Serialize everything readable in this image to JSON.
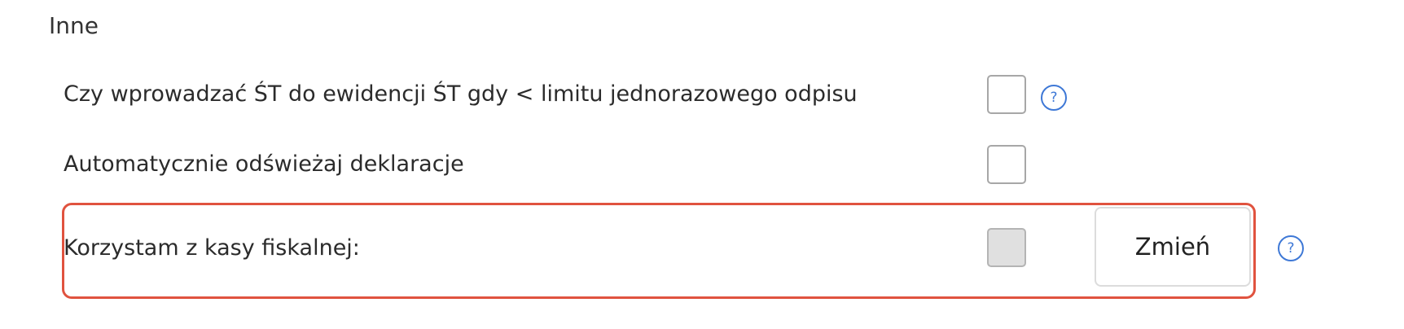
{
  "section": {
    "title": "Inne"
  },
  "rows": [
    {
      "label": "Czy wprowadzać ŚT do ewidencji ŚT gdy < limitu jednorazowego odpisu",
      "checkbox_checked": false,
      "checkbox_disabled": false,
      "help_icon": "question-circle-icon"
    },
    {
      "label": "Automatycznie odświeżaj deklaracje",
      "checkbox_checked": false,
      "checkbox_disabled": false
    },
    {
      "label": "Korzystam z kasy fiskalnej:",
      "checkbox_checked": false,
      "checkbox_disabled": true,
      "button_label": "Zmień",
      "help_icon": "question-circle-icon",
      "highlighted": true
    }
  ],
  "icons": {
    "help_glyph": "?"
  },
  "colors": {
    "accent": "#3e78d6",
    "highlight_border": "#e0533f",
    "disabled_checkbox": "#e0e0e0",
    "checkbox_border": "#a7a7a7"
  }
}
